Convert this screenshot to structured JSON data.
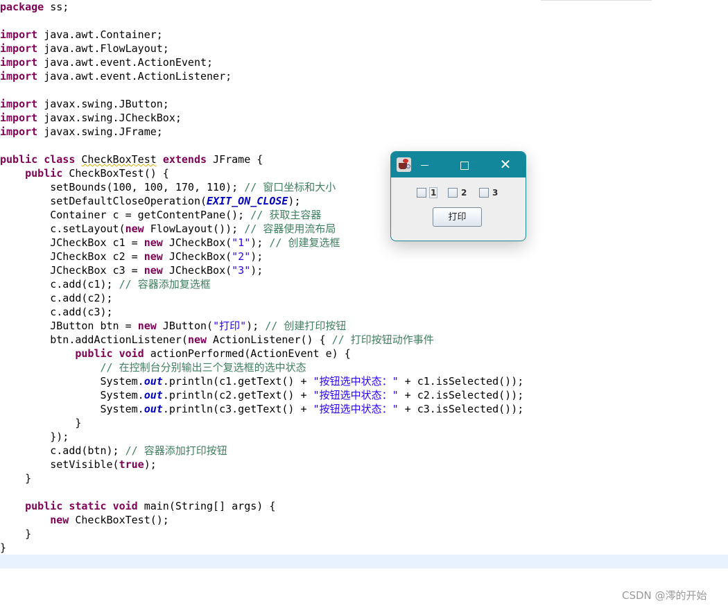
{
  "code_lines": [
    "package ss;",
    "",
    "import java.awt.Container;",
    "import java.awt.FlowLayout;",
    "import java.awt.event.ActionEvent;",
    "import java.awt.event.ActionListener;",
    "",
    "import javax.swing.JButton;",
    "import javax.swing.JCheckBox;",
    "import javax.swing.JFrame;",
    "",
    "public class CheckBoxTest extends JFrame {",
    "    public CheckBoxTest() {",
    "        setBounds(100, 100, 170, 110); // 窗口坐标和大小",
    "        setDefaultCloseOperation(EXIT_ON_CLOSE);",
    "        Container c = getContentPane(); // 获取主容器",
    "        c.setLayout(new FlowLayout()); // 容器使用流布局",
    "        JCheckBox c1 = new JCheckBox(\"1\"); // 创建复选框",
    "        JCheckBox c2 = new JCheckBox(\"2\");",
    "        JCheckBox c3 = new JCheckBox(\"3\");",
    "        c.add(c1); // 容器添加复选框",
    "        c.add(c2);",
    "        c.add(c3);",
    "        JButton btn = new JButton(\"打印\"); // 创建打印按钮",
    "        btn.addActionListener(new ActionListener() { // 打印按钮动作事件",
    "            public void actionPerformed(ActionEvent e) {",
    "                // 在控制台分别输出三个复选框的选中状态",
    "                System.out.println(c1.getText() + \"按钮选中状态：\" + c1.isSelected());",
    "                System.out.println(c2.getText() + \"按钮选中状态：\" + c2.isSelected());",
    "                System.out.println(c3.getText() + \"按钮选中状态：\" + c3.isSelected());",
    "            }",
    "        });",
    "        c.add(btn); // 容器添加打印按钮",
    "        setVisible(true);",
    "    }",
    "",
    "    public static void main(String[] args) {",
    "        new CheckBoxTest();",
    "    }",
    "}",
    ""
  ],
  "swing_window": {
    "checkboxes": [
      {
        "label": "1",
        "checked": false
      },
      {
        "label": "2",
        "checked": false
      },
      {
        "label": "3",
        "checked": false
      }
    ],
    "button_label": "打印",
    "title_color": "#12869b"
  },
  "icons": {
    "app_icon": "java-coffee-cup-icon",
    "minimize": "minimize-icon",
    "maximize": "maximize-icon",
    "close": "close-icon"
  },
  "watermark": "CSDN @澪的开始",
  "colors": {
    "keyword": "#7f0055",
    "string": "#2a00ff",
    "comment": "#3f7f5f",
    "field": "#0000c0",
    "current_line": "#e8f2fe"
  }
}
